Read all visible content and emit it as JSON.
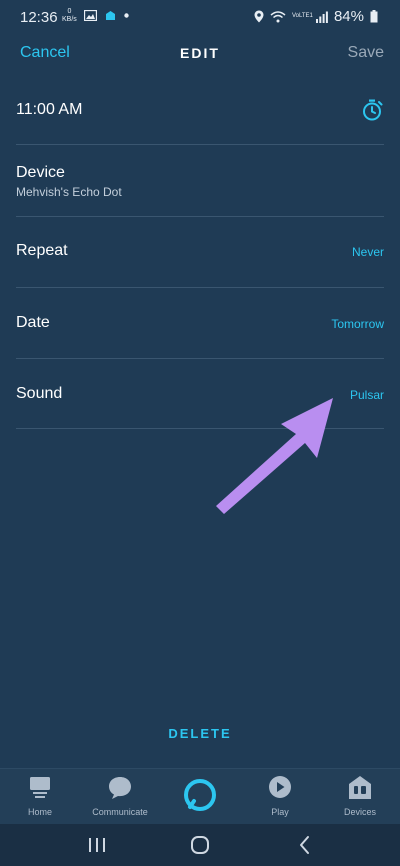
{
  "status_bar": {
    "time": "12:36",
    "kbs_value": "0",
    "kbs_unit": "KB/s",
    "network": "VoLTE1",
    "battery": "84%"
  },
  "header": {
    "cancel_label": "Cancel",
    "title": "EDIT",
    "save_label": "Save"
  },
  "alarm": {
    "time": "11:00 AM",
    "device_label": "Device",
    "device_value": "Mehvish's Echo Dot",
    "repeat_label": "Repeat",
    "repeat_value": "Never",
    "date_label": "Date",
    "date_value": "Tomorrow",
    "sound_label": "Sound",
    "sound_value": "Pulsar"
  },
  "delete_label": "DELETE",
  "bottom_nav": {
    "items": [
      {
        "label": "Home",
        "icon": "home-icon"
      },
      {
        "label": "Communicate",
        "icon": "chat-bubble-icon"
      },
      {
        "label": "",
        "icon": "alexa-ring-icon"
      },
      {
        "label": "Play",
        "icon": "play-icon"
      },
      {
        "label": "Devices",
        "icon": "devices-icon"
      }
    ]
  },
  "colors": {
    "background": "#1f3b55",
    "accent": "#2cc6f0",
    "annotation_arrow": "#b98ef0"
  }
}
